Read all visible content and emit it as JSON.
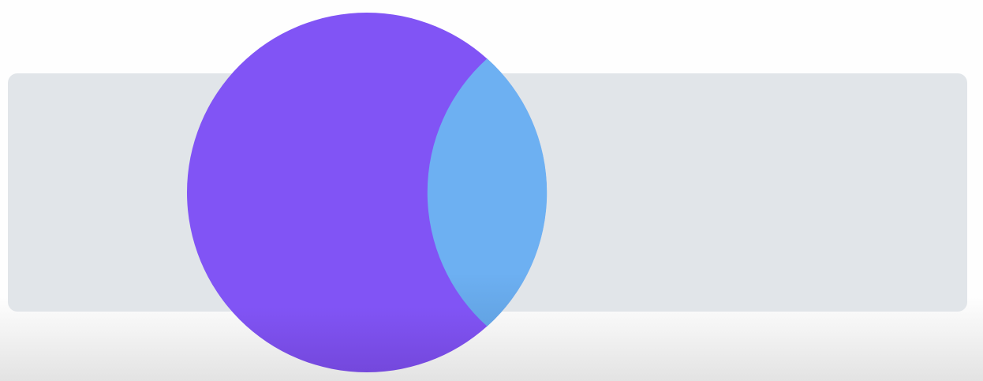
{
  "scene": {
    "colors": {
      "page_background_top": "#fefefe",
      "page_background_bottom": "#e3e3e3",
      "panel_fill": "#e1e5e9",
      "circle_purple": "#8154f5",
      "circle_purple_shadow": "#7448dc",
      "overlap_blue": "#6db0f2",
      "overlap_blue_shadow": "#62a3e3"
    }
  }
}
